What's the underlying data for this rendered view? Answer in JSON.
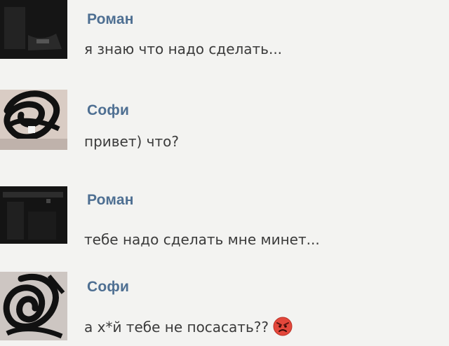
{
  "messages": [
    {
      "sender": "Роман",
      "text": "я знаю что надо сделать...",
      "avatar_icon": "dark-photo-avatar"
    },
    {
      "sender": "Софи",
      "text": "привет) что?",
      "avatar_icon": "scribbled-photo-avatar"
    },
    {
      "sender": "Роман",
      "text": "тебе надо сделать мне минет...",
      "avatar_icon": "dark-photo-avatar"
    },
    {
      "sender": "Софи",
      "text": "а х*й тебе не посасать??",
      "avatar_icon": "scribbled-photo-avatar",
      "emoji": "angry-face-emoji"
    }
  ],
  "colors": {
    "sender_name": "#4e6f92",
    "message_text": "#3b3b3b",
    "background": "#f3f3f1",
    "emoji_red": "#e3473b"
  }
}
